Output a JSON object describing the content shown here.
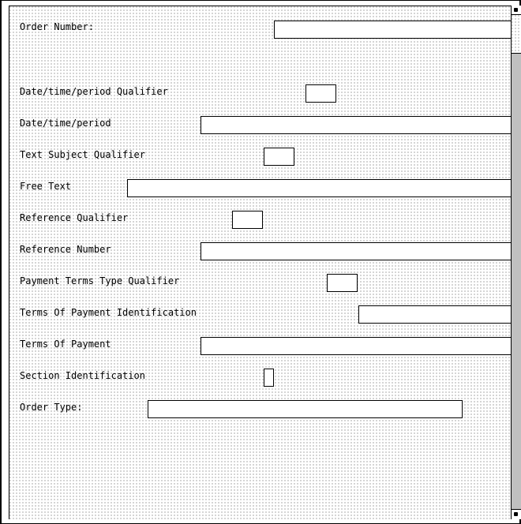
{
  "form": {
    "fields": [
      {
        "label": "Order Number:",
        "value": ""
      },
      {
        "label": "Date/time/period Qualifier",
        "value": ""
      },
      {
        "label": "Date/time/period",
        "value": ""
      },
      {
        "label": "Text Subject Qualifier",
        "value": ""
      },
      {
        "label": "Free Text",
        "value": ""
      },
      {
        "label": "Reference Qualifier",
        "value": ""
      },
      {
        "label": "Reference Number",
        "value": ""
      },
      {
        "label": "Payment Terms Type Qualifier",
        "value": ""
      },
      {
        "label": "Terms Of Payment Identification",
        "value": ""
      },
      {
        "label": "Terms Of Payment",
        "value": ""
      },
      {
        "label": "Section Identification",
        "value": ""
      },
      {
        "label": "Order Type:",
        "value": ""
      }
    ]
  },
  "scrollbar": {
    "up_icon": "arrow-up-icon",
    "down_icon": "arrow-down-icon"
  }
}
